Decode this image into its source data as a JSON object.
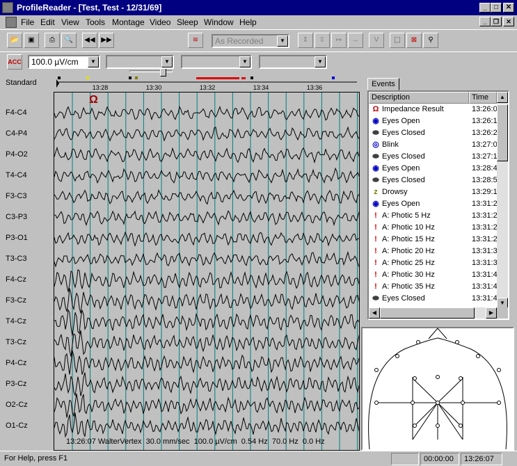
{
  "window": {
    "title": "ProfileReader - [Test, Test - 12/31/69]",
    "minimize": "_",
    "maximize": "□",
    "close": "✕"
  },
  "menu": [
    "File",
    "Edit",
    "View",
    "Tools",
    "Montage",
    "Video",
    "Sleep",
    "Window",
    "Help"
  ],
  "toolbar": {
    "display_mode": "As Recorded",
    "sensitivity": "100.0 µV/cm",
    "acc_label": "ACC",
    "combo1": "",
    "combo2": "",
    "combo3": ""
  },
  "montage": {
    "name": "Standard",
    "channels": [
      "F4-C4",
      "C4-P4",
      "P4-O2",
      "T4-C4",
      "F3-C3",
      "C3-P3",
      "P3-O1",
      "T3-C3",
      "F4-Cz",
      "F3-Cz",
      "T4-Cz",
      "T3-Cz",
      "P4-Cz",
      "P3-Cz",
      "O2-Cz",
      "O1-Cz"
    ]
  },
  "timeline": {
    "ticks": [
      "13:28",
      "13:30",
      "13:32",
      "13:34",
      "13:36"
    ]
  },
  "trace_status": {
    "time": "13:26:07",
    "reference": "WalterVertex",
    "paper_speed": "30.0 mm/sec",
    "sensitivity": "100.0 µV/cm",
    "low_filter": "0.54 Hz",
    "high_filter": "70.0 Hz",
    "notch": "0.0 Hz"
  },
  "events": {
    "tab_label": "Events",
    "col_description": "Description",
    "col_time": "Time",
    "rows": [
      {
        "icon": "impedance-icon",
        "desc": "Impedance Result",
        "time": "13:26:0"
      },
      {
        "icon": "eye-open-icon",
        "desc": "Eyes Open",
        "time": "13:26:1"
      },
      {
        "icon": "eye-closed-icon",
        "desc": "Eyes Closed",
        "time": "13:26:2"
      },
      {
        "icon": "blink-icon",
        "desc": "Blink",
        "time": "13:27:0"
      },
      {
        "icon": "eye-closed-icon",
        "desc": "Eyes Closed",
        "time": "13:27:1"
      },
      {
        "icon": "eye-open-icon",
        "desc": "Eyes Open",
        "time": "13:28:4"
      },
      {
        "icon": "eye-closed-icon",
        "desc": "Eyes Closed",
        "time": "13:28:5"
      },
      {
        "icon": "drowsy-icon",
        "desc": "Drowsy",
        "time": "13:29:1"
      },
      {
        "icon": "eye-open-icon",
        "desc": "Eyes Open",
        "time": "13:31:2"
      },
      {
        "icon": "photic-icon",
        "desc": "A: Photic 5 Hz",
        "time": "13:31:2"
      },
      {
        "icon": "photic-icon",
        "desc": "A: Photic 10 Hz",
        "time": "13:31:2"
      },
      {
        "icon": "photic-icon",
        "desc": "A: Photic 15 Hz",
        "time": "13:31:2"
      },
      {
        "icon": "photic-icon",
        "desc": "A: Photic 20 Hz",
        "time": "13:31:3"
      },
      {
        "icon": "photic-icon",
        "desc": "A: Photic 25 Hz",
        "time": "13:31:3"
      },
      {
        "icon": "photic-icon",
        "desc": "A: Photic 30 Hz",
        "time": "13:31:4"
      },
      {
        "icon": "photic-icon",
        "desc": "A: Photic 35 Hz",
        "time": "13:31:4"
      },
      {
        "icon": "eye-closed-icon",
        "desc": "Eyes Closed",
        "time": "13:31:4"
      }
    ]
  },
  "trace_marker": "Ω",
  "statusbar": {
    "help": "For Help, press F1",
    "elapsed": "00:00:00",
    "clock": "13:26:07"
  }
}
